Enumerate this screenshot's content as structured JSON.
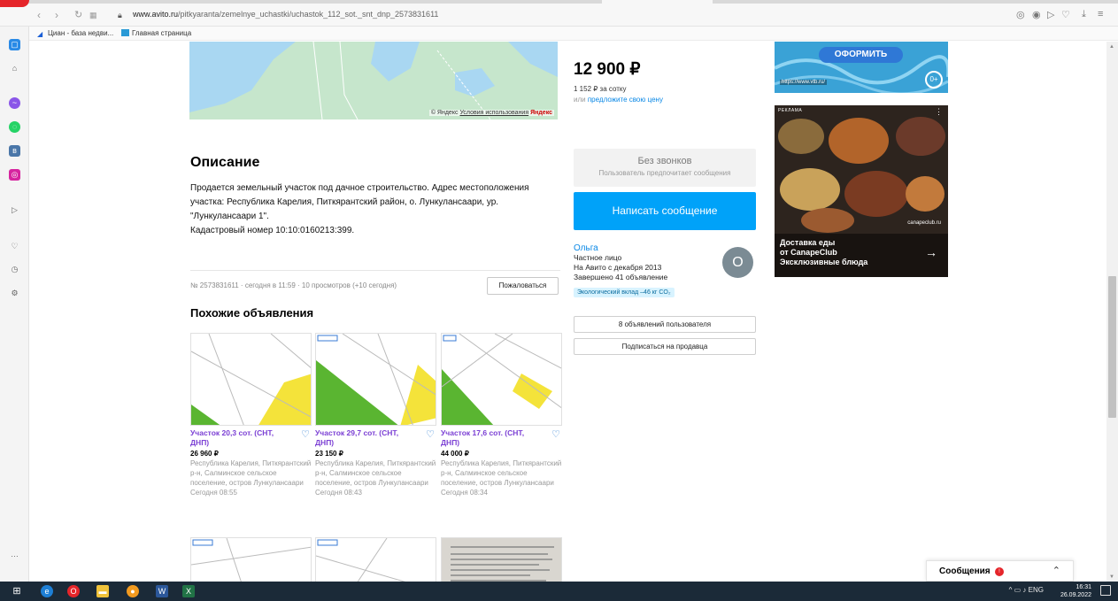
{
  "browser": {
    "url_host": "www.avito.ru",
    "url_path": "/pitkyaranta/zemelnye_uchastki/uchastok_112_sot._snt_dnp_2573831611",
    "bookmarks": [
      "Циан - база недви...",
      "Главная страница"
    ]
  },
  "map": {
    "credit_prefix": "© Яндекс",
    "credit_link": "Условия использования",
    "credit_brand": "Яндекс"
  },
  "description": {
    "title": "Описание",
    "text": "Продается земельный участок под дачное строительство. Адрес местоположения участка: Республика Карелия, Питкярантский район, о. Лункулансаари, ур. \"Лункулансаари 1\".",
    "cadastral": "Кадастровый номер 10:10:0160213:399."
  },
  "meta": "№ 2573831611 · сегодня в 11:59 · 10 просмотров (+10 сегодня)",
  "report_button": "Пожаловаться",
  "similar": {
    "title": "Похожие объявления",
    "items": [
      {
        "title": "Участок 20,3 сот. (СНТ, ДНП)",
        "price": "26 960 ₽",
        "addr": "Республика Карелия, Питкярантский р-н, Салминское сельское поселение, остров Лункулансаари",
        "time": "Сегодня 08:55"
      },
      {
        "title": "Участок 29,7 сот. (СНТ, ДНП)",
        "price": "23 150 ₽",
        "addr": "Республика Карелия, Питкярантский р-н, Салминское сельское поселение, остров Лункулансаари",
        "time": "Сегодня 08:43"
      },
      {
        "title": "Участок 17,6 сот. (СНТ, ДНП)",
        "price": "44 000 ₽",
        "addr": "Республика Карелия, Питкярантский р-н, Салминское сельское поселение, остров Лункулансаари",
        "time": "Сегодня 08:34"
      }
    ]
  },
  "listing": {
    "price": "12 900 ₽",
    "per_sotka": "1 152 ₽ за сотку",
    "offer_prefix": "или",
    "offer_link": "предложите свою цену"
  },
  "contact": {
    "no_calls_title": "Без звонков",
    "no_calls_sub": "Пользователь предпочитает сообщения",
    "message_button": "Написать сообщение"
  },
  "seller": {
    "name": "Ольга",
    "type": "Частное лицо",
    "since": "На Авито с декабря 2013",
    "completed": "Завершено 41 объявление",
    "eco": "Экологический вклад –46 кг CO₂",
    "avatar_letter": "О",
    "listings_button": "8 объявлений пользователя",
    "subscribe_button": "Подписаться на продавца"
  },
  "ads": {
    "ad1_button": "ОФОРМИТЬ",
    "ad1_url": "https://www.vtb.ru/",
    "ad1_age": "0+",
    "ad2_label": "РЕКЛАМА",
    "ad2_brand": "canapeclub.ru",
    "ad2_caption_1": "Доставка еды",
    "ad2_caption_2": "от CanapeClub",
    "ad2_caption_3": "Эксклюзивные блюда"
  },
  "chat": {
    "label": "Сообщения"
  },
  "taskbar": {
    "lang": "ENG",
    "time": "16:31",
    "date": "26.09.2022"
  },
  "colors": {
    "accent_blue": "#00a2f9",
    "link_blue": "#0a88e6",
    "similar_title_purple": "#7b3fd4"
  }
}
